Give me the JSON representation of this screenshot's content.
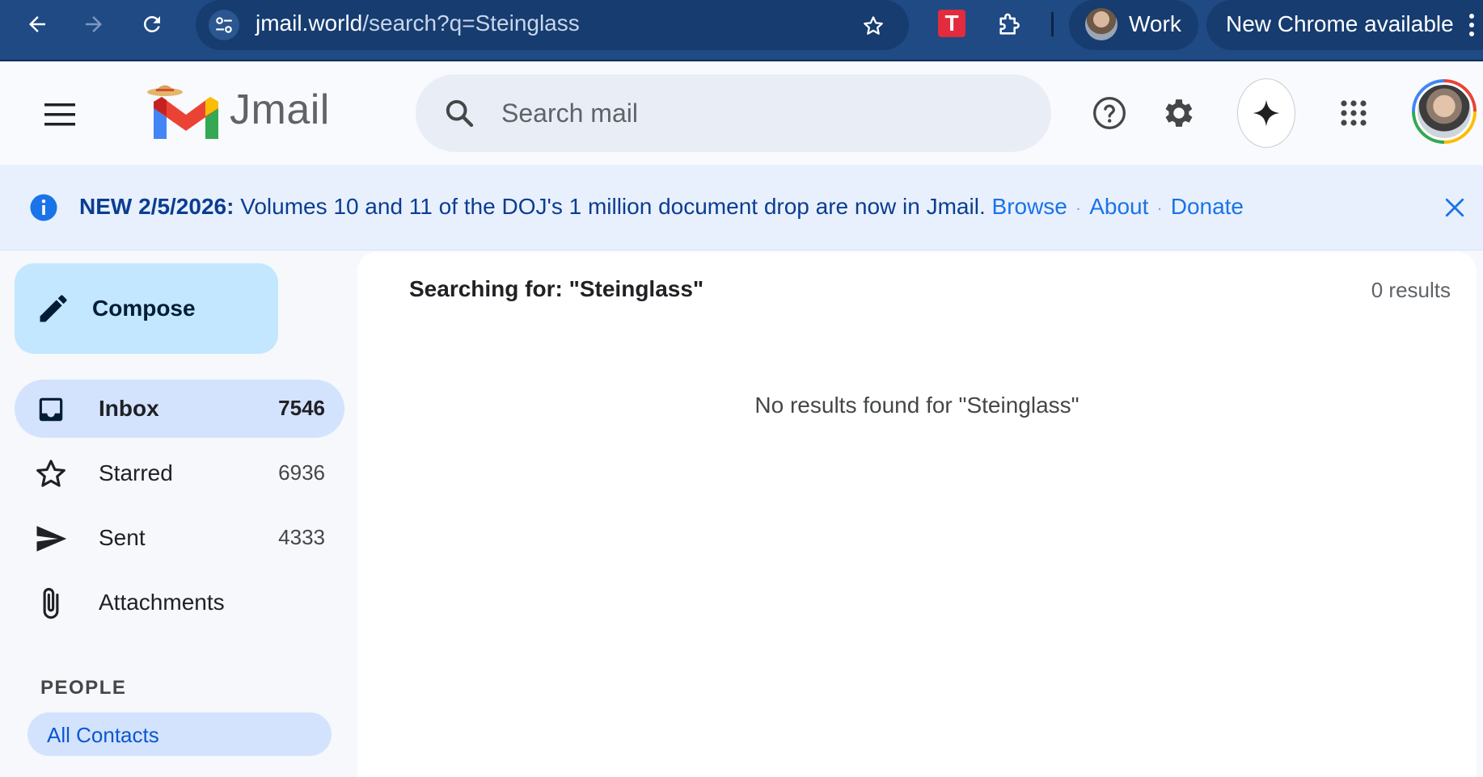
{
  "browser": {
    "url_host": "jmail.world",
    "url_path": "/search?q=Steinglass",
    "extension_label": "T",
    "profile_label": "Work",
    "update_label": "New Chrome available"
  },
  "header": {
    "app_name": "Jmail",
    "search_placeholder": "Search mail"
  },
  "banner": {
    "prefix": "NEW 2/5/2026:",
    "message": " Volumes 10 and 11 of the DOJ's 1 million document drop are now in Jmail. ",
    "links": [
      "Browse",
      "About",
      "Donate"
    ],
    "separator": "·"
  },
  "sidebar": {
    "compose_label": "Compose",
    "items": [
      {
        "label": "Inbox",
        "count": "7546",
        "icon": "inbox-icon"
      },
      {
        "label": "Starred",
        "count": "6936",
        "icon": "star-icon"
      },
      {
        "label": "Sent",
        "count": "4333",
        "icon": "send-icon"
      },
      {
        "label": "Attachments",
        "count": "",
        "icon": "paperclip-icon"
      }
    ],
    "people_title": "PEOPLE",
    "contacts_label": "All Contacts"
  },
  "main": {
    "searching_for": "Searching for: \"Steinglass\"",
    "results_count": "0 results",
    "empty_message": "No results found for \"Steinglass\""
  },
  "colors": {
    "chrome": "#1f4a84",
    "accent": "#1a73e8",
    "compose": "#c2e7ff",
    "active_nav": "#d3e3fd",
    "banner": "#e8f0fe"
  }
}
